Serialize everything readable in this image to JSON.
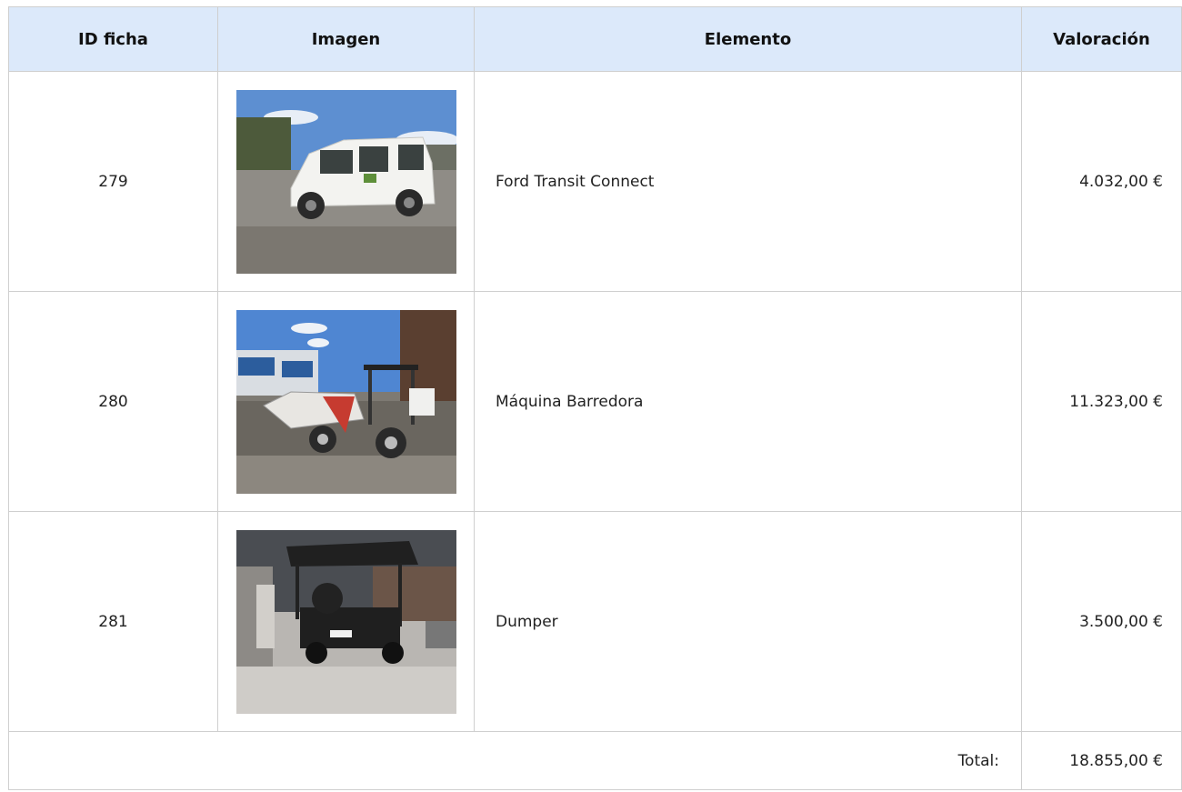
{
  "table": {
    "headers": {
      "id": "ID ficha",
      "image": "Imagen",
      "element": "Elemento",
      "value": "Valoración"
    },
    "rows": [
      {
        "id": "279",
        "image_icon": "white-van-photo",
        "element": "Ford Transit Connect",
        "value": "4.032,00 €"
      },
      {
        "id": "280",
        "image_icon": "street-sweeper-photo",
        "element": "Máquina Barredora",
        "value": "11.323,00 €"
      },
      {
        "id": "281",
        "image_icon": "dumper-photo",
        "element": "Dumper",
        "value": "3.500,00 €"
      }
    ],
    "total_label": "Total:",
    "total_value": "18.855,00 €"
  }
}
